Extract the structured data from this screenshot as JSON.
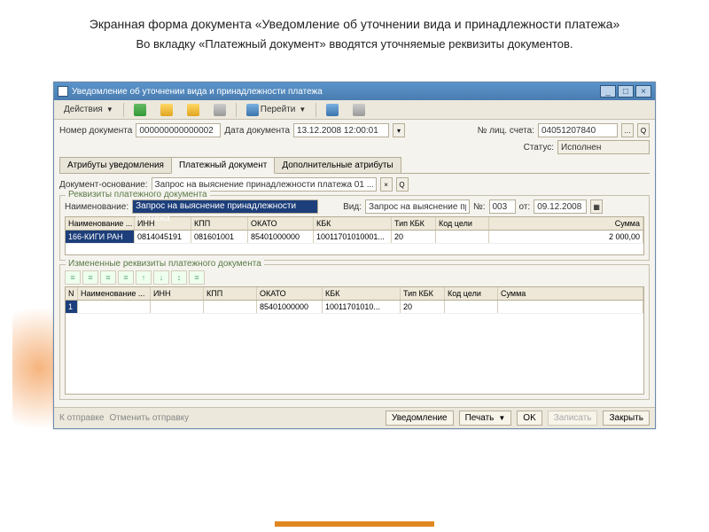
{
  "page": {
    "title": "Экранная форма документа «Уведомление об уточнении вида и принадлежности платежа»",
    "subtitle": "Во вкладку «Платежный документ»  вводятся уточняемые реквизиты документов."
  },
  "window": {
    "title": "Уведомление об уточнении вида и принадлежности платежа"
  },
  "menubar": {
    "actions": "Действия",
    "goto": "Перейти"
  },
  "header": {
    "doc_no_label": "Номер документа",
    "doc_no": "000000000000002",
    "doc_date_label": "Дата документа",
    "doc_date": "13.12.2008 12:00:01",
    "account_label": "№ лиц. счета:",
    "account": "04051207840",
    "status_label": "Статус:",
    "status": "Исполнен"
  },
  "tabs": {
    "t1": "Атрибуты уведомления",
    "t2": "Платежный документ",
    "t3": "Дополнительные атрибуты"
  },
  "basis": {
    "label": "Документ-основание:",
    "value": "Запрос на выяснение принадлежности платежа 01 ..."
  },
  "req": {
    "legend": "Реквизиты платежного документа",
    "name_label": "Наименование:",
    "name": "Запрос на выяснение принадлежности платежа",
    "kind_label": "Вид:",
    "kind": "Запрос на выяснение при...",
    "num_label": "№:",
    "num": "003",
    "from_label": "от:",
    "from": "09.12.2008"
  },
  "grid1": {
    "h": [
      "Наименование ...",
      "ИНН",
      "КПП",
      "ОКАТО",
      "КБК",
      "Тип КБК",
      "Код цели",
      "Сумма"
    ],
    "r": [
      "166-КИГИ РАН",
      "0814045191",
      "081601001",
      "85401000000",
      "10011701010001...",
      "20",
      "",
      "2 000,00"
    ]
  },
  "changed": {
    "legend": "Измененные реквизиты платежного документа"
  },
  "grid2": {
    "h": [
      "N",
      "Наименование ...",
      "ИНН",
      "КПП",
      "ОКАТО",
      "КБК",
      "Тип КБК",
      "Код цели",
      "Сумма"
    ],
    "r": [
      "1",
      "",
      "",
      "",
      "85401000000",
      "10011701010...",
      "20",
      "",
      ""
    ]
  },
  "footer": {
    "send": "К отправке",
    "cancel_send": "Отменить отправку",
    "notice": "Уведомление",
    "print": "Печать",
    "ok": "OK",
    "save": "Записать",
    "close": "Закрыть"
  }
}
